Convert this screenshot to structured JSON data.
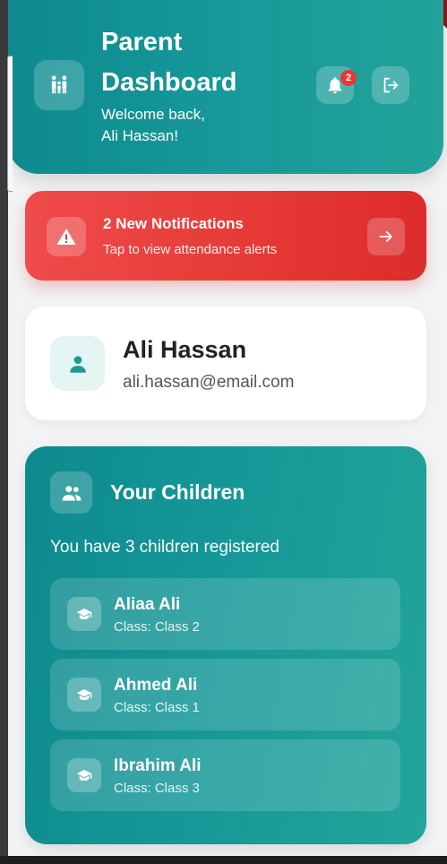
{
  "header": {
    "title_line1": "Parent",
    "title_line2": "Dashboard",
    "welcome_line1": "Welcome back,",
    "welcome_line2": "Ali Hassan!",
    "notification_count": "2",
    "icons": {
      "family": "family-icon",
      "bell": "bell-icon",
      "logout": "logout-icon"
    }
  },
  "alert": {
    "title": "2 New Notifications",
    "subtitle": "Tap to view attendance alerts",
    "icons": {
      "warning": "warning-icon",
      "arrow": "arrow-right-icon"
    }
  },
  "profile": {
    "name": "Ali Hassan",
    "email": "ali.hassan@email.com",
    "icon": "person-icon"
  },
  "children_section": {
    "title": "Your Children",
    "count_text": "You have 3 children registered",
    "icon": "group-icon",
    "items": [
      {
        "name": "Aliaa Ali",
        "class": "Class: Class 2"
      },
      {
        "name": "Ahmed Ali",
        "class": "Class: Class 1"
      },
      {
        "name": "Ibrahim Ali",
        "class": "Class: Class 3"
      }
    ]
  },
  "colors": {
    "teal_primary": "#0d8a8e",
    "teal_secondary": "#21a39a",
    "alert_red": "#e53935",
    "background": "#f1f3f5"
  }
}
